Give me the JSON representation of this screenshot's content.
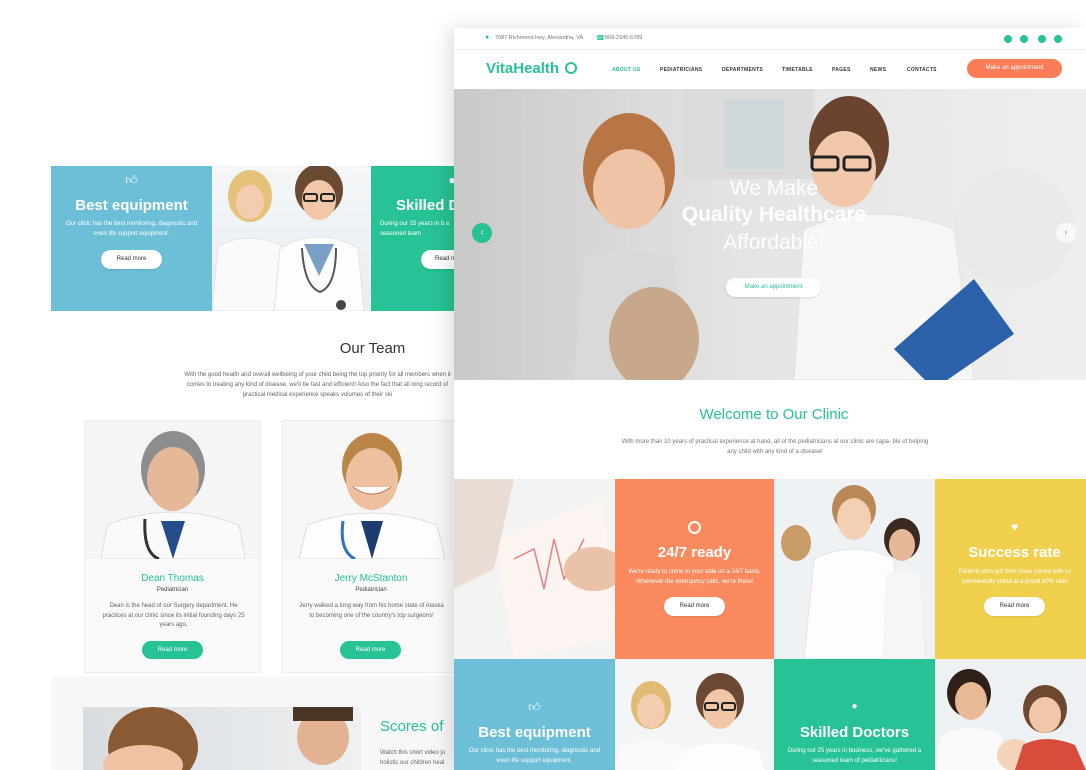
{
  "colors": {
    "teal": "#27c295",
    "blue": "#6dbfd8",
    "orange": "#fb8a5e",
    "yellow": "#f1d04e",
    "primary_btn": "#fb7d57"
  },
  "back": {
    "feature_blue": {
      "title": "Best equipment",
      "text": "Our clinic has the best monitoring, diagnostic and even life support equipment.",
      "button": "Read more",
      "icon": "thumbs-up-icon"
    },
    "feature_teal": {
      "title": "Skilled D",
      "text": "During our 25 years in b a seasoned team",
      "button": "Read m",
      "icon": "user-icon"
    },
    "team": {
      "title": "Our Team",
      "intro": "With the good health and overall wellbeing of your child being the top priority for all members when it comes to treating any kind of disease, we'll be fast and efficient! Also the fact that all long record of practical medical experience speaks volumes of their ski",
      "members": [
        {
          "name": "Dean Thomas",
          "role": "Pediatrician",
          "bio": "Dean is the head of our Surgery department. He practices at our clinic since its initial founding days 25 years ago.",
          "button": "Read more"
        },
        {
          "name": "Jerry McStanton",
          "role": "Pediatrician",
          "bio": "Jerry walked a long way from his home state of Alaska to becoming one of the country's top surgeons!",
          "button": "Read more"
        }
      ]
    },
    "scores": {
      "title": "Scores of",
      "text": "Watch this short video ju holistic our children heal"
    }
  },
  "front": {
    "topbar": {
      "address": "7087 Richmond hwy, Alexandria, VA",
      "phone": "800-2345-6789",
      "social": [
        "facebook-icon",
        "twitter-icon",
        "google-plus-icon",
        "instagram-icon"
      ]
    },
    "logo": "VitaHealth",
    "nav": [
      "ABOUT US",
      "PEDIATRICIANS",
      "DEPARTMENTS",
      "TIMETABLE",
      "PAGES",
      "NEWS",
      "CONTACTS"
    ],
    "nav_button": "Make an appointment",
    "hero": {
      "line1": "We Make",
      "line2": "Quality Healthcare",
      "line3": "Affordable!",
      "button": "Make an appointment"
    },
    "welcome": {
      "title": "Welcome to Our Clinic",
      "text": "With more than 10 years of practical experience at hand, all of the pediatricians at our clinic are capa- ble of helping any child with any kind of a disease!"
    },
    "features": [
      {
        "title": "24/7 ready",
        "text": "We're ready to come to your aide on a 24/7 basis. Whenever the emergency calls, we're there!",
        "button": "Read more",
        "icon": "clock-icon"
      },
      {
        "title": "Success rate",
        "text": "Patients who got their issue solved with us permanently stand at a proud 80% rate!",
        "button": "Read more",
        "icon": "heart-icon"
      },
      {
        "title": "Best equipment",
        "text": "Our clinic has the best monitoring, diagnostic and even life support equipment.",
        "icon": "thumbs-up-icon"
      },
      {
        "title": "Skilled Doctors",
        "text": "During our 25 years in business, we've gathered a seasoned team of pediatricians!",
        "icon": "user-icon"
      }
    ]
  }
}
